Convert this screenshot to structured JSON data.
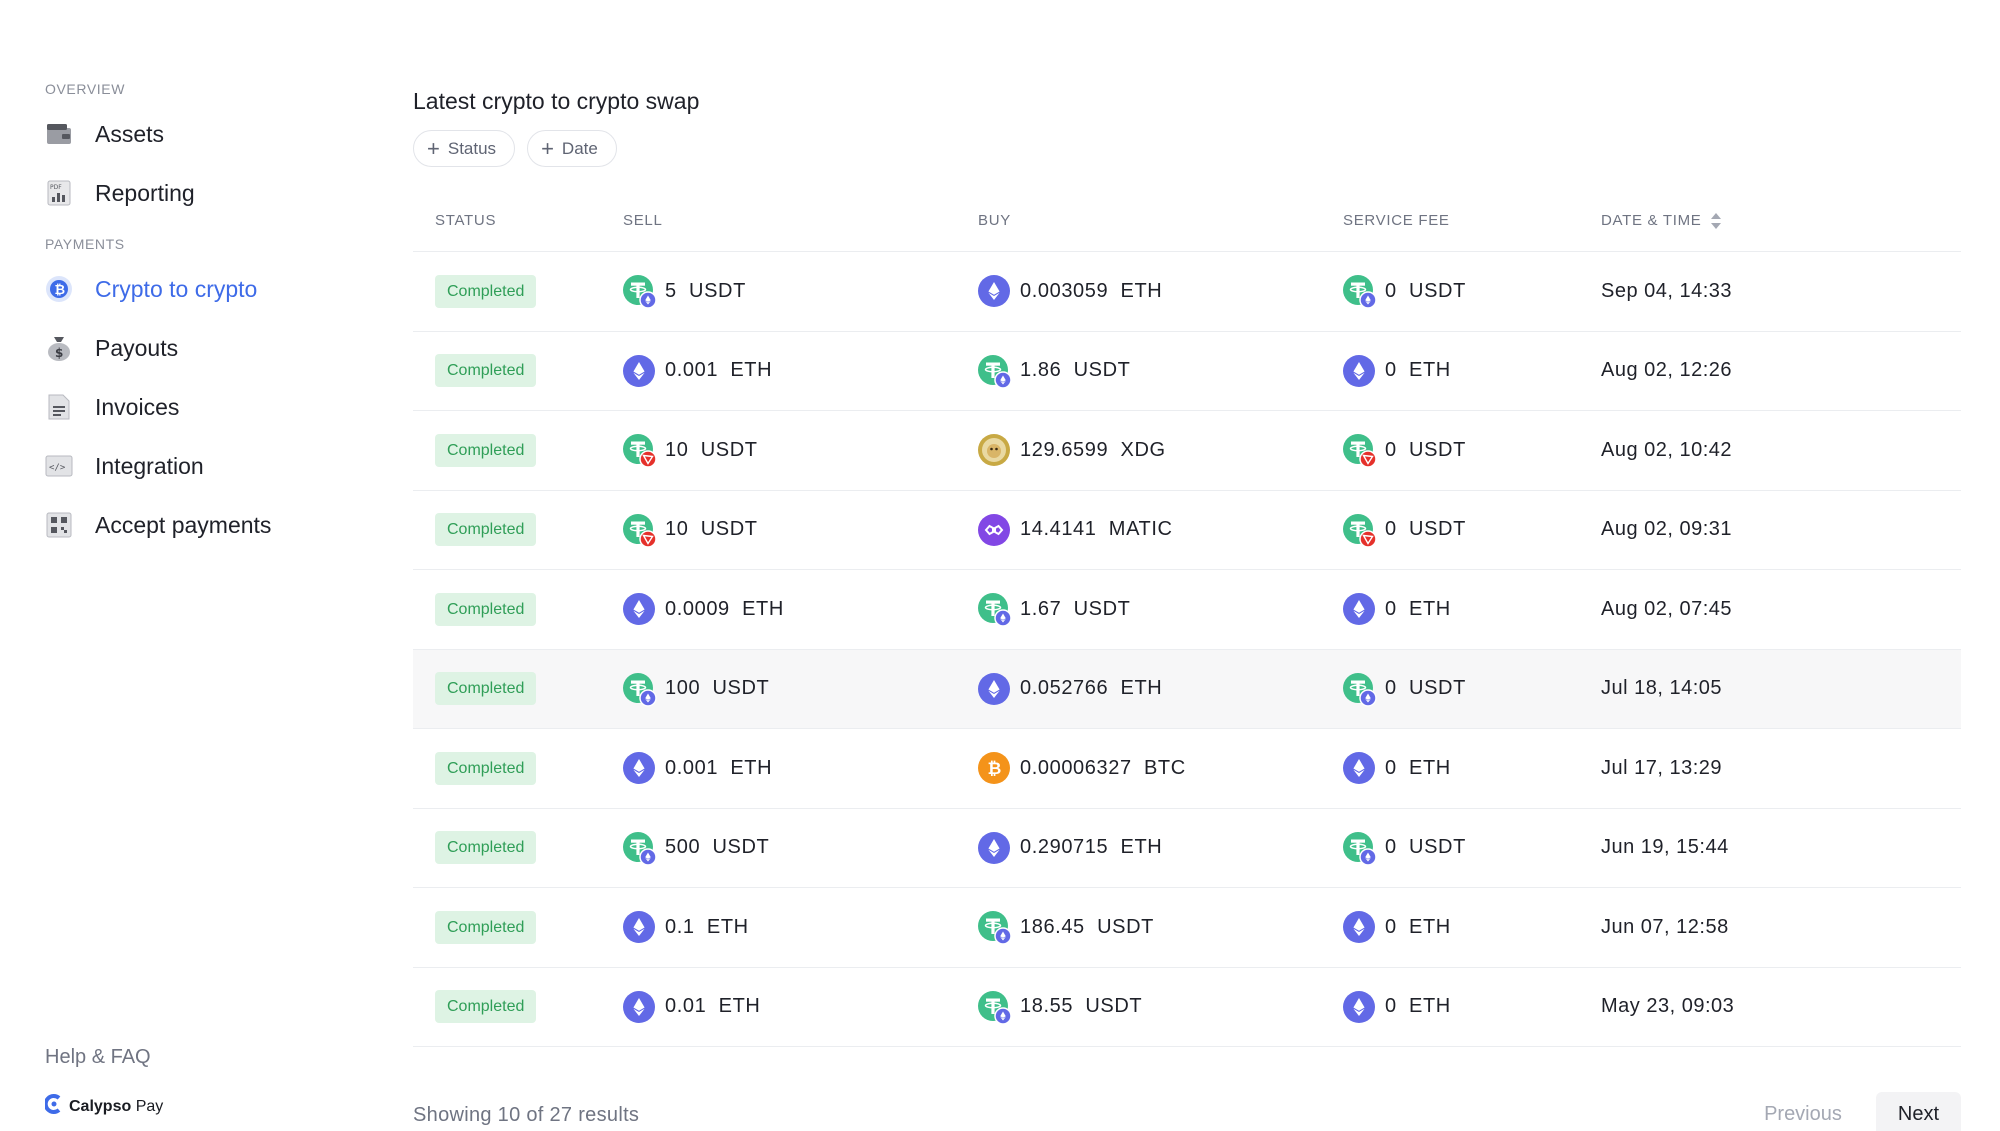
{
  "sidebar": {
    "overview_label": "OVERVIEW",
    "payments_label": "PAYMENTS",
    "items": [
      {
        "label": "Assets",
        "icon": "wallet-icon"
      },
      {
        "label": "Reporting",
        "icon": "pdf-report-icon"
      },
      {
        "label": "Crypto to crypto",
        "icon": "bitcoin-icon",
        "active": true
      },
      {
        "label": "Payouts",
        "icon": "money-bag-icon"
      },
      {
        "label": "Invoices",
        "icon": "document-icon"
      },
      {
        "label": "Integration",
        "icon": "code-icon"
      },
      {
        "label": "Accept payments",
        "icon": "qr-code-icon"
      }
    ],
    "help_label": "Help & FAQ",
    "brand": {
      "name_bold": "Calypso",
      "name_light": "Pay"
    }
  },
  "main": {
    "title": "Latest crypto to crypto swap",
    "filters": [
      {
        "label": "Status"
      },
      {
        "label": "Date"
      }
    ],
    "columns": {
      "status": "STATUS",
      "sell": "SELL",
      "buy": "BUY",
      "fee": "SERVICE FEE",
      "date": "DATE & TIME"
    },
    "rows": [
      {
        "status": "Completed",
        "sell": "5  USDT",
        "sell_coin": "usdt-eth",
        "buy": "0.003059  ETH",
        "buy_coin": "eth",
        "fee": "0  USDT",
        "fee_coin": "usdt-eth",
        "date": "Sep 04, 14:33"
      },
      {
        "status": "Completed",
        "sell": "0.001  ETH",
        "sell_coin": "eth",
        "buy": "1.86  USDT",
        "buy_coin": "usdt-eth",
        "fee": "0  ETH",
        "fee_coin": "eth",
        "date": "Aug 02, 12:26"
      },
      {
        "status": "Completed",
        "sell": "10  USDT",
        "sell_coin": "usdt-trx",
        "buy": "129.6599  XDG",
        "buy_coin": "doge",
        "fee": "0  USDT",
        "fee_coin": "usdt-trx",
        "date": "Aug 02, 10:42"
      },
      {
        "status": "Completed",
        "sell": "10  USDT",
        "sell_coin": "usdt-trx",
        "buy": "14.4141  MATIC",
        "buy_coin": "matic",
        "fee": "0  USDT",
        "fee_coin": "usdt-trx",
        "date": "Aug 02, 09:31"
      },
      {
        "status": "Completed",
        "sell": "0.0009  ETH",
        "sell_coin": "eth",
        "buy": "1.67  USDT",
        "buy_coin": "usdt-eth",
        "fee": "0  ETH",
        "fee_coin": "eth",
        "date": "Aug 02, 07:45"
      },
      {
        "status": "Completed",
        "sell": "100  USDT",
        "sell_coin": "usdt-eth",
        "buy": "0.052766  ETH",
        "buy_coin": "eth",
        "fee": "0  USDT",
        "fee_coin": "usdt-eth",
        "date": "Jul 18, 14:05",
        "highlight": true
      },
      {
        "status": "Completed",
        "sell": "0.001  ETH",
        "sell_coin": "eth",
        "buy": "0.00006327  BTC",
        "buy_coin": "btc",
        "fee": "0  ETH",
        "fee_coin": "eth",
        "date": "Jul 17, 13:29"
      },
      {
        "status": "Completed",
        "sell": "500  USDT",
        "sell_coin": "usdt-eth",
        "buy": "0.290715  ETH",
        "buy_coin": "eth",
        "fee": "0  USDT",
        "fee_coin": "usdt-eth",
        "date": "Jun 19, 15:44"
      },
      {
        "status": "Completed",
        "sell": "0.1  ETH",
        "sell_coin": "eth",
        "buy": "186.45  USDT",
        "buy_coin": "usdt-eth",
        "fee": "0  ETH",
        "fee_coin": "eth",
        "date": "Jun 07, 12:58"
      },
      {
        "status": "Completed",
        "sell": "0.01  ETH",
        "sell_coin": "eth",
        "buy": "18.55  USDT",
        "buy_coin": "usdt-eth",
        "fee": "0  ETH",
        "fee_coin": "eth",
        "date": "May 23, 09:03"
      }
    ],
    "footer": {
      "summary": "Showing 10 of 27 results",
      "previous": "Previous",
      "next": "Next"
    }
  },
  "colors": {
    "accent": "#3e6be8",
    "badge_bg": "#def3e4",
    "badge_text": "#2f9e57",
    "eth": "#6269e6",
    "usdt": "#3fbf8a",
    "tron": "#e5312b",
    "btc": "#f4931a",
    "doge": "#c8a944",
    "matic": "#8247e5"
  }
}
